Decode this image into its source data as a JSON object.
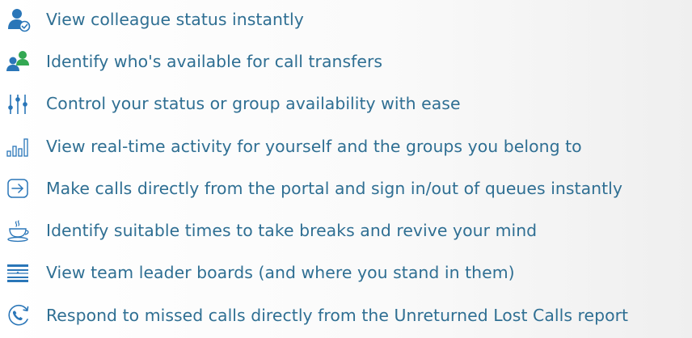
{
  "features": [
    {
      "icon": "user-check-icon",
      "label": "View colleague status instantly"
    },
    {
      "icon": "users-icon",
      "label": "Identify who's available for call transfers"
    },
    {
      "icon": "sliders-icon",
      "label": "Control your status or group availability with ease"
    },
    {
      "icon": "bar-chart-icon",
      "label": "View real-time activity for yourself and the groups you belong to"
    },
    {
      "icon": "sign-in-icon",
      "label": "Make calls directly from the portal and sign in/out of queues instantly"
    },
    {
      "icon": "coffee-cup-icon",
      "label": "Identify suitable times to take breaks and revive your mind"
    },
    {
      "icon": "leaderboard-icon",
      "label": "View team leader boards (and where you stand in them)"
    },
    {
      "icon": "missed-call-icon",
      "label": "Respond to missed calls directly from the Unreturned Lost Calls report"
    }
  ],
  "colors": {
    "text": "#2f6f93",
    "icon_blue": "#2a76b8",
    "icon_green": "#33a852"
  }
}
